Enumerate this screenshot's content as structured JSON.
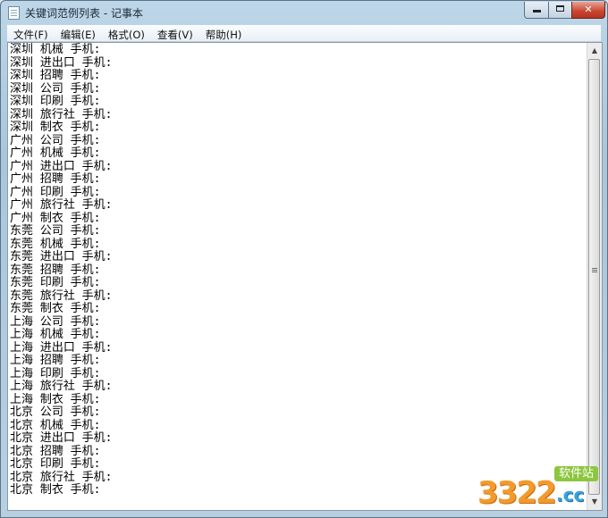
{
  "window": {
    "title": "关键词范例列表 - 记事本",
    "controls": {
      "minimize": "",
      "maximize": "",
      "close": "✕"
    }
  },
  "menu": [
    "文件(F)",
    "编辑(E)",
    "格式(O)",
    "查看(V)",
    "帮助(H)"
  ],
  "document": {
    "lines": [
      "深圳 机械 手机:",
      "深圳 进出口 手机:",
      "深圳 招聘 手机:",
      "深圳 公司 手机:",
      "深圳 印刷 手机:",
      "深圳 旅行社 手机:",
      "深圳 制衣 手机:",
      "广州 公司 手机:",
      "广州 机械 手机:",
      "广州 进出口 手机:",
      "广州 招聘 手机:",
      "广州 印刷 手机:",
      "广州 旅行社 手机:",
      "广州 制衣 手机:",
      "东莞 公司 手机:",
      "东莞 机械 手机:",
      "东莞 进出口 手机:",
      "东莞 招聘 手机:",
      "东莞 印刷 手机:",
      "东莞 旅行社 手机:",
      "东莞 制衣 手机:",
      "上海 公司 手机:",
      "上海 机械 手机:",
      "上海 进出口 手机:",
      "上海 招聘 手机:",
      "上海 印刷 手机:",
      "上海 旅行社 手机:",
      "上海 制衣 手机:",
      "北京 公司 手机:",
      "北京 机械 手机:",
      "北京 进出口 手机:",
      "北京 招聘 手机:",
      "北京 印刷 手机:",
      "北京 旅行社 手机:",
      "北京 制衣 手机:"
    ]
  },
  "watermark": {
    "number": "3322",
    "site": "软件站",
    "domain": ".cc"
  },
  "icons": {
    "app": "notepad-icon",
    "scroll_up": "arrow-up-icon",
    "scroll_down": "arrow-down-icon"
  }
}
